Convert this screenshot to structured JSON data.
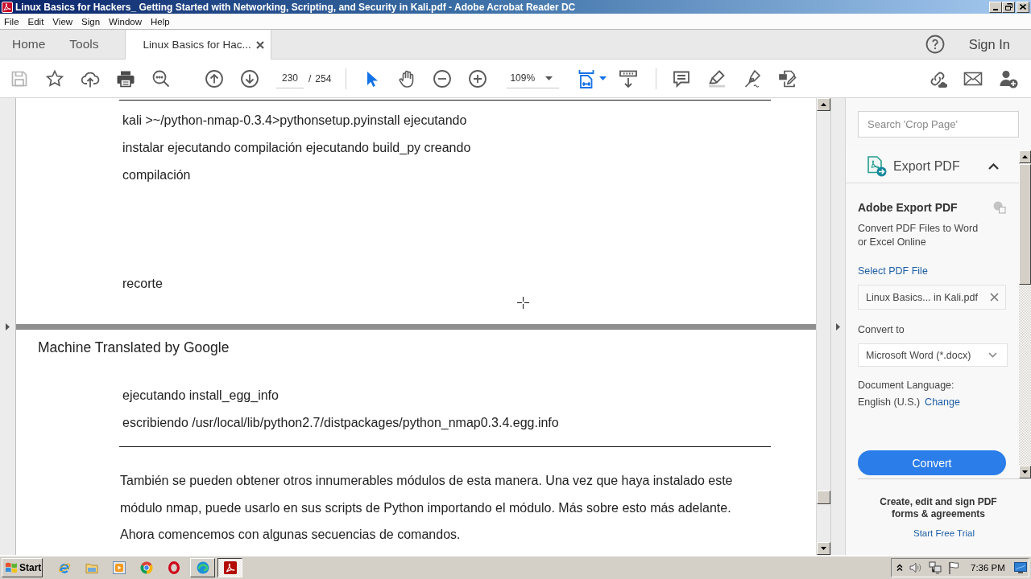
{
  "window": {
    "title": "Linux Basics for Hackers_ Getting Started with Networking, Scripting, and Security in Kali.pdf - Adobe Acrobat Reader DC"
  },
  "menu_bar": [
    "File",
    "Edit",
    "View",
    "Sign",
    "Window",
    "Help"
  ],
  "tabs": [
    {
      "label": "Home",
      "selected": false,
      "closable": false
    },
    {
      "label": "Tools",
      "selected": false,
      "closable": false
    },
    {
      "label": "Linux Basics for Hac...",
      "selected": true,
      "closable": true
    }
  ],
  "account": {
    "sign_in": "Sign In"
  },
  "toolbar": {
    "save": {
      "disabled": true
    },
    "page_number": "230",
    "page_separator": "/",
    "page_count": "254",
    "select_tool": {
      "selected": true
    },
    "hand_tool": {
      "selected": false
    },
    "zoom": "109%"
  },
  "document": {
    "pages": [
      {
        "blocks": [
          {
            "kind": "rule"
          },
          {
            "kind": "code",
            "lines": [
              "kali >~/python-nmap-0.3.4>pythonsetup.pyinstall ejecutando",
              "instalar ejecutando compilación ejecutando build_py creando",
              "compilación"
            ]
          },
          {
            "kind": "code",
            "lines": [
              "recorte"
            ]
          }
        ]
      },
      {
        "blocks": [
          {
            "kind": "header",
            "text": "Machine Translated by Google"
          },
          {
            "kind": "code",
            "lines": [
              "ejecutando install_egg_info",
              "escribiendo /usr/local/lib/python2.7/distpackages/python_nmap0.3.4.egg.info"
            ]
          },
          {
            "kind": "rule"
          },
          {
            "kind": "paragraph",
            "lines": [
              "También se pueden obtener otros innumerables módulos de esta manera. Una vez que haya instalado este",
              "módulo nmap, puede usarlo en sus scripts de Python importando el módulo. Más sobre esto más adelante.",
              "Ahora comencemos con algunas secuencias de comandos."
            ]
          }
        ]
      }
    ]
  },
  "right_panel": {
    "search": {
      "placeholder": "Search 'Crop Page'"
    },
    "section": {
      "title": "Export PDF",
      "expanded": true
    },
    "export": {
      "heading": "Adobe Export PDF",
      "description": [
        "Convert PDF Files to Word",
        "or Excel Online"
      ],
      "select_label": "Select PDF File",
      "file": "Linux Basics... in Kali.pdf",
      "convert_to_label": "Convert to",
      "format": "Microsoft Word (*.docx)",
      "language_label": "Document Language:",
      "language": "English (U.S.)",
      "change_link": "Change",
      "convert_button": "Convert"
    },
    "promo": {
      "lines": [
        "Create, edit and sign PDF",
        "forms & agreements"
      ],
      "link": "Start Free Trial"
    }
  },
  "taskbar": {
    "start": "Start",
    "tasks": [
      {
        "kind": "browser",
        "selected": false
      },
      {
        "kind": "pdf",
        "selected": true
      }
    ],
    "clock": "7:36 PM"
  }
}
